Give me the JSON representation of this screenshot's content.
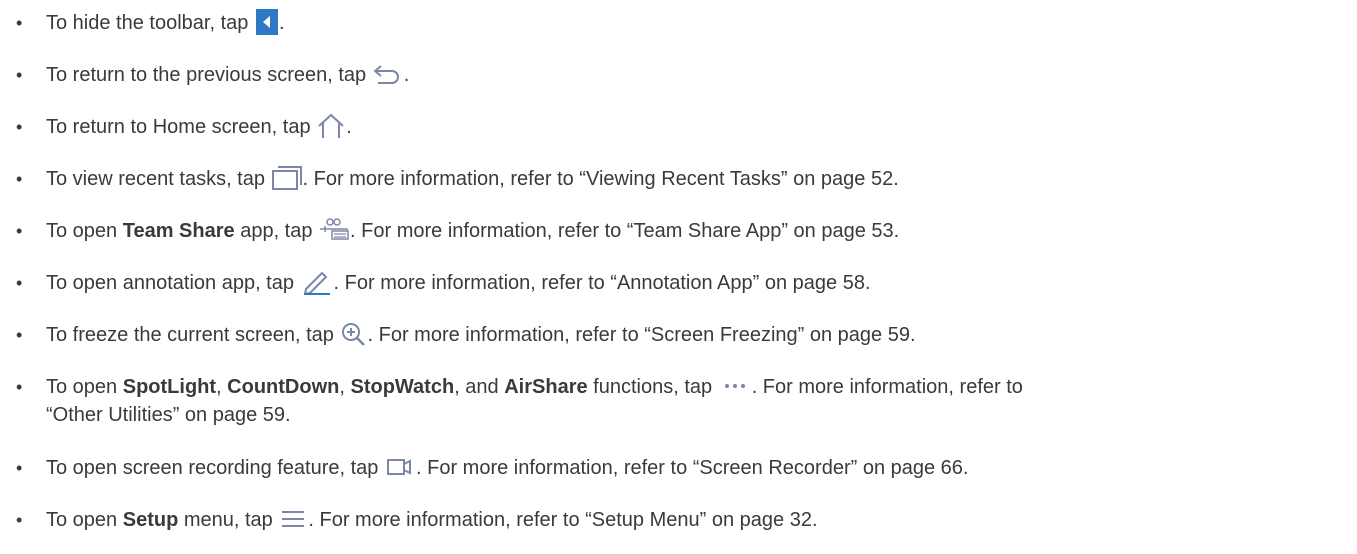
{
  "icon_color": "#7b86a8",
  "accent_color": "#2e79c6",
  "items": [
    {
      "pre": "To hide the toolbar, tap ",
      "icon": "hide-toolbar-icon",
      "post": "."
    },
    {
      "pre": "To return to the previous screen, tap ",
      "icon": "back-arrow-icon",
      "post": "."
    },
    {
      "pre": "To return to Home screen, tap ",
      "icon": "home-icon",
      "post": "."
    },
    {
      "pre": "To view recent tasks, tap ",
      "icon": "recent-tasks-icon",
      "post": ". For more information, refer to “Viewing Recent Tasks” on page 52."
    },
    {
      "pre": "To open ",
      "bold": "Team Share",
      "mid": " app, tap ",
      "icon": "team-share-icon",
      "post": ". For more information, refer to “Team Share App” on page 53."
    },
    {
      "pre": "To open annotation app, tap ",
      "icon": "pencil-icon",
      "post": ". For more information, refer to “Annotation App” on page 58."
    },
    {
      "pre": "To freeze the current screen, tap ",
      "icon": "zoom-in-icon",
      "post": ". For more information, refer to “Screen Freezing” on page 59."
    },
    {
      "pre": "To open ",
      "bold1": "SpotLight",
      "sep1": ", ",
      "bold2": "CountDown",
      "sep2": ", ",
      "bold3": "StopWatch",
      "sep3": ", and ",
      "bold4": "AirShare",
      "mid": " functions, tap ",
      "icon": "more-dots-icon",
      "post": ". For more information, refer to",
      "line2": "“Other Utilities” on page 59."
    },
    {
      "pre": "To open screen recording feature, tap ",
      "icon": "screen-recorder-icon",
      "post": ". For more information, refer to “Screen Recorder” on page 66."
    },
    {
      "pre": "To open ",
      "bold": "Setup",
      "mid": " menu, tap ",
      "icon": "menu-icon",
      "post": ". For more information, refer to “Setup Menu” on page 32."
    }
  ]
}
